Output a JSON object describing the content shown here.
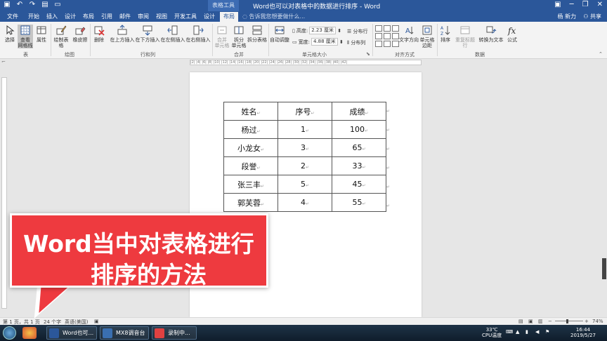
{
  "titlebar": {
    "qat_icons": [
      "save-icon",
      "undo-icon",
      "redo-icon",
      "open-icon",
      "print-preview-icon"
    ],
    "context_tab_title": "表格工具",
    "doc_title": "Word也可以对表格中的数据进行排序 - Word"
  },
  "tabs": {
    "file": "文件",
    "home": "开始",
    "insert": "插入",
    "design": "设计",
    "layout": "布局",
    "references": "引用",
    "mailings": "邮件",
    "review": "审阅",
    "view": "视图",
    "developer": "开发工具",
    "table_design": "设计",
    "table_layout": "布局",
    "tell_me": "告诉我您想要做什么...",
    "user": "杨 新力",
    "share": "共享"
  },
  "ribbon": {
    "select": "选择",
    "view_gridlines_1": "查看",
    "view_gridlines_2": "网格线",
    "properties": "属性",
    "group_table": "表",
    "draw_table": "绘制表格",
    "eraser": "橡皮擦",
    "group_draw": "绘图",
    "delete": "删除",
    "insert_above": "在上方插入",
    "insert_below": "在下方插入",
    "insert_left": "在左侧插入",
    "insert_right": "在右侧插入",
    "group_rows_cols": "行和列",
    "merge_cells_1": "合并",
    "merge_cells_2": "单元格",
    "split_cells_1": "拆分",
    "split_cells_2": "单元格",
    "split_table": "拆分表格",
    "group_merge": "合并",
    "autofit": "自动调整",
    "height_label": "高度:",
    "height_value": "2.23 厘米",
    "width_label": "宽度:",
    "width_value": "4.88 厘米",
    "distribute_rows": "分布行",
    "distribute_cols": "分布列",
    "group_cell_size": "单元格大小",
    "text_direction": "文字方向",
    "cell_margins_1": "单元格",
    "cell_margins_2": "边距",
    "group_alignment": "对齐方式",
    "sort": "排序",
    "repeat_header": "重复标题行",
    "convert_to_text": "转换为文本",
    "formula": "公式",
    "group_data": "数据"
  },
  "ruler": {
    "marks": "|2| |4| |6| |8| |10| |12| |14| |16| |18| |20| |22| |24| |26| |28| |30| |32| |34| |36| |38| |40| |42|"
  },
  "table": {
    "header": [
      "姓名",
      "序号",
      "成绩"
    ],
    "rows": [
      [
        "杨过",
        "1",
        "100"
      ],
      [
        "小龙女",
        "3",
        "65"
      ],
      [
        "段誉",
        "2",
        "33"
      ],
      [
        "张三丰",
        "5",
        "45"
      ],
      [
        "郭芙蓉",
        "4",
        "55"
      ]
    ]
  },
  "statusbar": {
    "page": "第 1 页，共 1 页",
    "words": "24 个字",
    "language": "英语(美国)",
    "zoom": "74%"
  },
  "taskbar": {
    "task_word": "Word也可...",
    "task_mx8": "MX8调音台",
    "task_rec": "录制中...",
    "cpu_temp": "33℃",
    "cpu_label": "CPU温度",
    "time": "16:44",
    "date": "2019/5/27"
  },
  "overlay": {
    "line1": "Word当中对表格进行",
    "line2": "排序的方法"
  },
  "colors": {
    "word_blue": "#2b579a",
    "callout_red": "#ee3a3f"
  }
}
